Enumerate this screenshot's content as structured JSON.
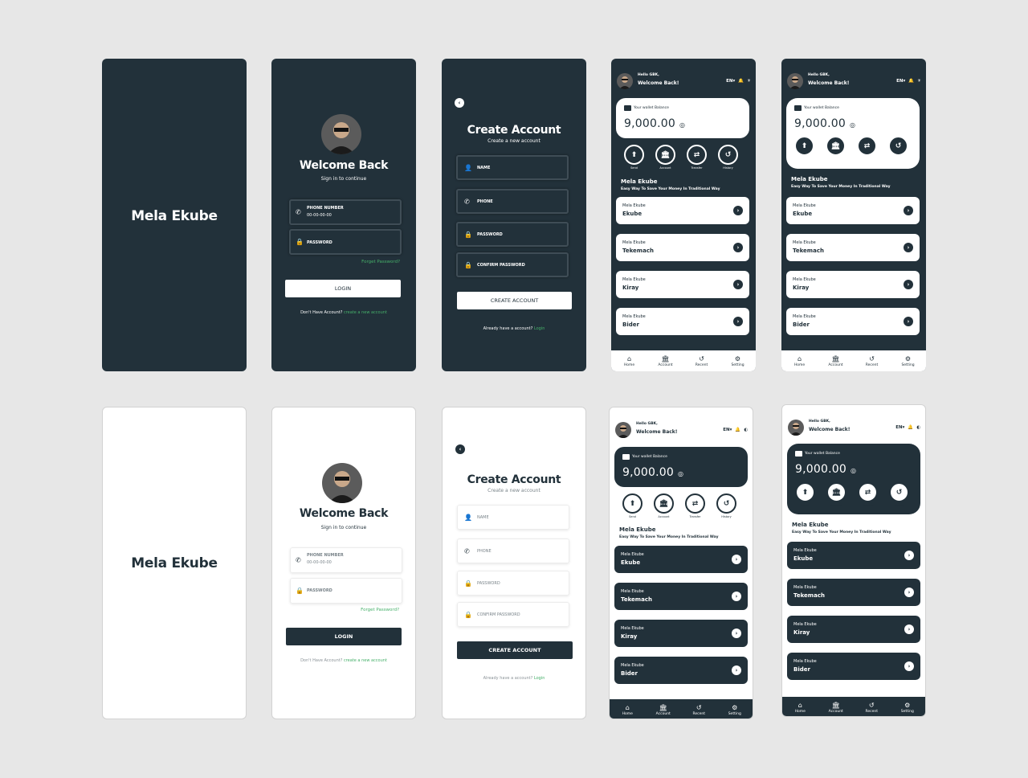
{
  "app_name": "Mela Ekube",
  "login": {
    "title": "Welcome Back",
    "subtitle": "Sign in to continue",
    "phone_label": "PHONE NUMBER",
    "phone_value": "00-00-00-00",
    "password_label": "PASSWORD",
    "forgot": "Forget Password?",
    "button": "LOGIN",
    "footer_text": "Don't Have Account?",
    "footer_link": "create a new account"
  },
  "create": {
    "title": "Create Account",
    "subtitle": "Create a new account",
    "fields": [
      "NAME",
      "PHONE",
      "PASSWORD",
      "CONFIRM PASSWORD"
    ],
    "button": "CREATE ACCOUNT",
    "footer_text": "Already have a account?",
    "footer_link": "Login"
  },
  "home": {
    "hello": "Hello GBK,",
    "welcome": "Welcome Back!",
    "language": "EN",
    "wallet_label": "Your wallet Balance",
    "balance": "9,000.00",
    "quick_actions": [
      {
        "label": "Send",
        "icon": "arrow-up-icon"
      },
      {
        "label": "Account",
        "icon": "bank-icon"
      },
      {
        "label": "Transfer",
        "icon": "transfer-icon"
      },
      {
        "label": "History",
        "icon": "history-icon"
      }
    ],
    "section_title": "Mela Ekube",
    "section_subtitle": "Easy Way To Save Your Money In Traditional Way",
    "items": [
      {
        "small": "Mela Ekube",
        "large": "Ekube"
      },
      {
        "small": "Mela Ekube",
        "large": "Tekemach"
      },
      {
        "small": "Mela Ekube",
        "large": "Kiray"
      },
      {
        "small": "Mela Ekube",
        "large": "Bider"
      }
    ],
    "nav": [
      {
        "label": "Home",
        "icon": "home-icon"
      },
      {
        "label": "Account",
        "icon": "bank-icon"
      },
      {
        "label": "Recent",
        "icon": "history-icon"
      },
      {
        "label": "Setting",
        "icon": "gear-icon"
      }
    ]
  },
  "colors": {
    "background": "#e7e7e7",
    "dark": "#22313a",
    "light": "#ffffff",
    "link": "#46b06a"
  }
}
